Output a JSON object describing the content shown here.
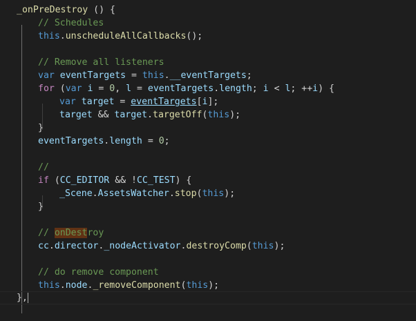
{
  "editor": {
    "theme": {
      "background": "#1e1e1e",
      "text": "#d4d4d4",
      "keyword": "#569cd6",
      "control": "#c586c0",
      "function": "#dcdcaa",
      "variable": "#9cdcfe",
      "number": "#b5cea8",
      "comment": "#6a9955",
      "property": "#9cdcfe",
      "highlight": "#613214"
    },
    "cursor_line": 23,
    "lines": [
      {
        "indent": 0,
        "tokens": [
          {
            "t": "_onPreDestroy",
            "c": "function"
          },
          {
            "t": " () {",
            "c": "text"
          }
        ]
      },
      {
        "indent": 1,
        "tokens": [
          {
            "t": "// Schedules",
            "c": "comment"
          }
        ]
      },
      {
        "indent": 1,
        "tokens": [
          {
            "t": "this",
            "c": "keyword"
          },
          {
            "t": ".",
            "c": "text"
          },
          {
            "t": "unscheduleAllCallbacks",
            "c": "function"
          },
          {
            "t": "();",
            "c": "text"
          }
        ]
      },
      {
        "indent": 0,
        "tokens": []
      },
      {
        "indent": 1,
        "tokens": [
          {
            "t": "// Remove all listeners",
            "c": "comment"
          }
        ]
      },
      {
        "indent": 1,
        "tokens": [
          {
            "t": "var",
            "c": "keyword"
          },
          {
            "t": " ",
            "c": "text"
          },
          {
            "t": "eventTargets",
            "c": "variable"
          },
          {
            "t": " = ",
            "c": "text"
          },
          {
            "t": "this",
            "c": "keyword"
          },
          {
            "t": ".",
            "c": "text"
          },
          {
            "t": "__eventTargets",
            "c": "property"
          },
          {
            "t": ";",
            "c": "text"
          }
        ]
      },
      {
        "indent": 1,
        "tokens": [
          {
            "t": "for",
            "c": "control"
          },
          {
            "t": " (",
            "c": "text"
          },
          {
            "t": "var",
            "c": "keyword"
          },
          {
            "t": " ",
            "c": "text"
          },
          {
            "t": "i",
            "c": "variable"
          },
          {
            "t": " = ",
            "c": "text"
          },
          {
            "t": "0",
            "c": "number"
          },
          {
            "t": ", ",
            "c": "text"
          },
          {
            "t": "l",
            "c": "variable"
          },
          {
            "t": " = ",
            "c": "text"
          },
          {
            "t": "eventTargets",
            "c": "variable"
          },
          {
            "t": ".",
            "c": "text"
          },
          {
            "t": "length",
            "c": "property"
          },
          {
            "t": "; ",
            "c": "text"
          },
          {
            "t": "i",
            "c": "variable"
          },
          {
            "t": " < ",
            "c": "text"
          },
          {
            "t": "l",
            "c": "variable"
          },
          {
            "t": "; ++",
            "c": "text"
          },
          {
            "t": "i",
            "c": "variable"
          },
          {
            "t": ") {",
            "c": "text"
          }
        ]
      },
      {
        "indent": 2,
        "tokens": [
          {
            "t": "var",
            "c": "keyword"
          },
          {
            "t": " ",
            "c": "text"
          },
          {
            "t": "target",
            "c": "variable"
          },
          {
            "t": " = ",
            "c": "text"
          },
          {
            "t": "eventTargets",
            "c": "variable",
            "u": true
          },
          {
            "t": "[",
            "c": "text"
          },
          {
            "t": "i",
            "c": "variable"
          },
          {
            "t": "];",
            "c": "text"
          }
        ]
      },
      {
        "indent": 2,
        "tokens": [
          {
            "t": "target",
            "c": "variable"
          },
          {
            "t": " && ",
            "c": "text"
          },
          {
            "t": "target",
            "c": "variable"
          },
          {
            "t": ".",
            "c": "text"
          },
          {
            "t": "targetOff",
            "c": "function"
          },
          {
            "t": "(",
            "c": "text"
          },
          {
            "t": "this",
            "c": "keyword"
          },
          {
            "t": ");",
            "c": "text"
          }
        ]
      },
      {
        "indent": 1,
        "tokens": [
          {
            "t": "}",
            "c": "text"
          }
        ]
      },
      {
        "indent": 1,
        "tokens": [
          {
            "t": "eventTargets",
            "c": "variable"
          },
          {
            "t": ".",
            "c": "text"
          },
          {
            "t": "length",
            "c": "property"
          },
          {
            "t": " = ",
            "c": "text"
          },
          {
            "t": "0",
            "c": "number"
          },
          {
            "t": ";",
            "c": "text"
          }
        ]
      },
      {
        "indent": 0,
        "tokens": []
      },
      {
        "indent": 1,
        "tokens": [
          {
            "t": "//",
            "c": "comment"
          }
        ]
      },
      {
        "indent": 1,
        "tokens": [
          {
            "t": "if",
            "c": "control"
          },
          {
            "t": " (",
            "c": "text"
          },
          {
            "t": "CC_EDITOR",
            "c": "variable"
          },
          {
            "t": " && !",
            "c": "text"
          },
          {
            "t": "CC_TEST",
            "c": "variable"
          },
          {
            "t": ") {",
            "c": "text"
          }
        ]
      },
      {
        "indent": 2,
        "tokens": [
          {
            "t": "_Scene",
            "c": "variable"
          },
          {
            "t": ".",
            "c": "text"
          },
          {
            "t": "AssetsWatcher",
            "c": "variable"
          },
          {
            "t": ".",
            "c": "text"
          },
          {
            "t": "stop",
            "c": "function"
          },
          {
            "t": "(",
            "c": "text"
          },
          {
            "t": "this",
            "c": "keyword"
          },
          {
            "t": ");",
            "c": "text"
          }
        ]
      },
      {
        "indent": 1,
        "tokens": [
          {
            "t": "}",
            "c": "text"
          }
        ]
      },
      {
        "indent": 0,
        "tokens": []
      },
      {
        "indent": 1,
        "tokens": [
          {
            "t": "// ",
            "c": "comment"
          },
          {
            "t": "onDest",
            "c": "comment",
            "h": true
          },
          {
            "t": "roy",
            "c": "comment"
          }
        ]
      },
      {
        "indent": 1,
        "tokens": [
          {
            "t": "cc",
            "c": "variable"
          },
          {
            "t": ".",
            "c": "text"
          },
          {
            "t": "director",
            "c": "variable"
          },
          {
            "t": ".",
            "c": "text"
          },
          {
            "t": "_nodeActivator",
            "c": "variable"
          },
          {
            "t": ".",
            "c": "text"
          },
          {
            "t": "destroyComp",
            "c": "function"
          },
          {
            "t": "(",
            "c": "text"
          },
          {
            "t": "this",
            "c": "keyword"
          },
          {
            "t": ");",
            "c": "text"
          }
        ]
      },
      {
        "indent": 0,
        "tokens": []
      },
      {
        "indent": 1,
        "tokens": [
          {
            "t": "// do remove component",
            "c": "comment"
          }
        ]
      },
      {
        "indent": 1,
        "tokens": [
          {
            "t": "this",
            "c": "keyword"
          },
          {
            "t": ".",
            "c": "text"
          },
          {
            "t": "node",
            "c": "variable"
          },
          {
            "t": ".",
            "c": "text"
          },
          {
            "t": "_removeComponent",
            "c": "function"
          },
          {
            "t": "(",
            "c": "text"
          },
          {
            "t": "this",
            "c": "keyword"
          },
          {
            "t": ")",
            "c": "text"
          },
          {
            "t": ";",
            "c": "text"
          }
        ]
      },
      {
        "indent": 0,
        "tokens": [
          {
            "t": "},",
            "c": "text"
          }
        ]
      }
    ]
  }
}
